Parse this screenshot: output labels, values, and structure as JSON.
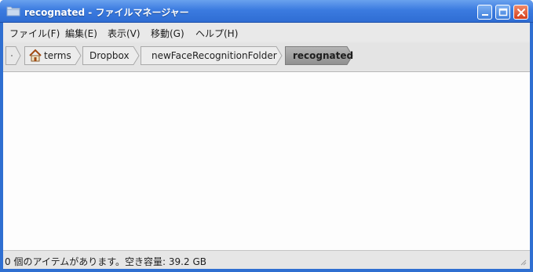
{
  "window": {
    "title": "recognated - ファイルマネージャー"
  },
  "menu": {
    "items": [
      {
        "label": "ファイル(F)"
      },
      {
        "label": "編集(E)"
      },
      {
        "label": "表示(V)"
      },
      {
        "label": "移動(G)"
      },
      {
        "label": "ヘルプ(H)"
      }
    ]
  },
  "pathbar": {
    "crumbs": [
      {
        "label": "terms",
        "icon": "home-icon"
      },
      {
        "label": "Dropbox"
      },
      {
        "label": "newFaceRecognitionFolder"
      },
      {
        "label": "recognated",
        "active": true
      }
    ]
  },
  "statusbar": {
    "text": "0 個のアイテムがあります。空き容量: 39.2 GB"
  },
  "colors": {
    "titlebar": "#3b7be0",
    "close_button": "#d4401e",
    "active_crumb": "#9a9a9a"
  }
}
